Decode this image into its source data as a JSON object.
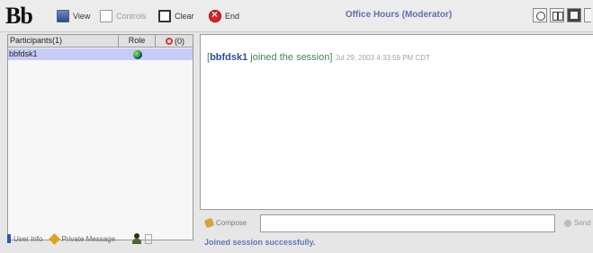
{
  "app": {
    "logo": "Bb",
    "title": "Office Hours (Moderator)"
  },
  "toolbar": {
    "view_label": "View",
    "controls_label": "Controls",
    "clear_label": "Clear",
    "end_label": "End"
  },
  "participants": {
    "header_name": "Participants(1)",
    "header_role": "Role",
    "header_hand_count": "(0)",
    "rows": [
      {
        "name": "bbfdsk1"
      }
    ]
  },
  "left_footer": {
    "user_info_label": "User Info",
    "private_message_label": "Private Message"
  },
  "chat": {
    "message_open_bracket": "[",
    "message_user": "bbfdsk1",
    "message_text": " joined the session]",
    "message_timestamp": "Jul 29, 2003 4:33:59 PM CDT"
  },
  "compose": {
    "compose_label": "Compose",
    "input_value": "",
    "send_label": "Send"
  },
  "status": {
    "text": "Joined session successfully."
  },
  "icons": [
    "view-icon",
    "controls-icon",
    "clear-icon",
    "end-icon",
    "view-mode-icons",
    "raise-hand-icon",
    "role-globe-icon",
    "info-icon",
    "private-message-icon",
    "person-icon",
    "lock-icon",
    "pencil-icon",
    "send-icon"
  ]
}
